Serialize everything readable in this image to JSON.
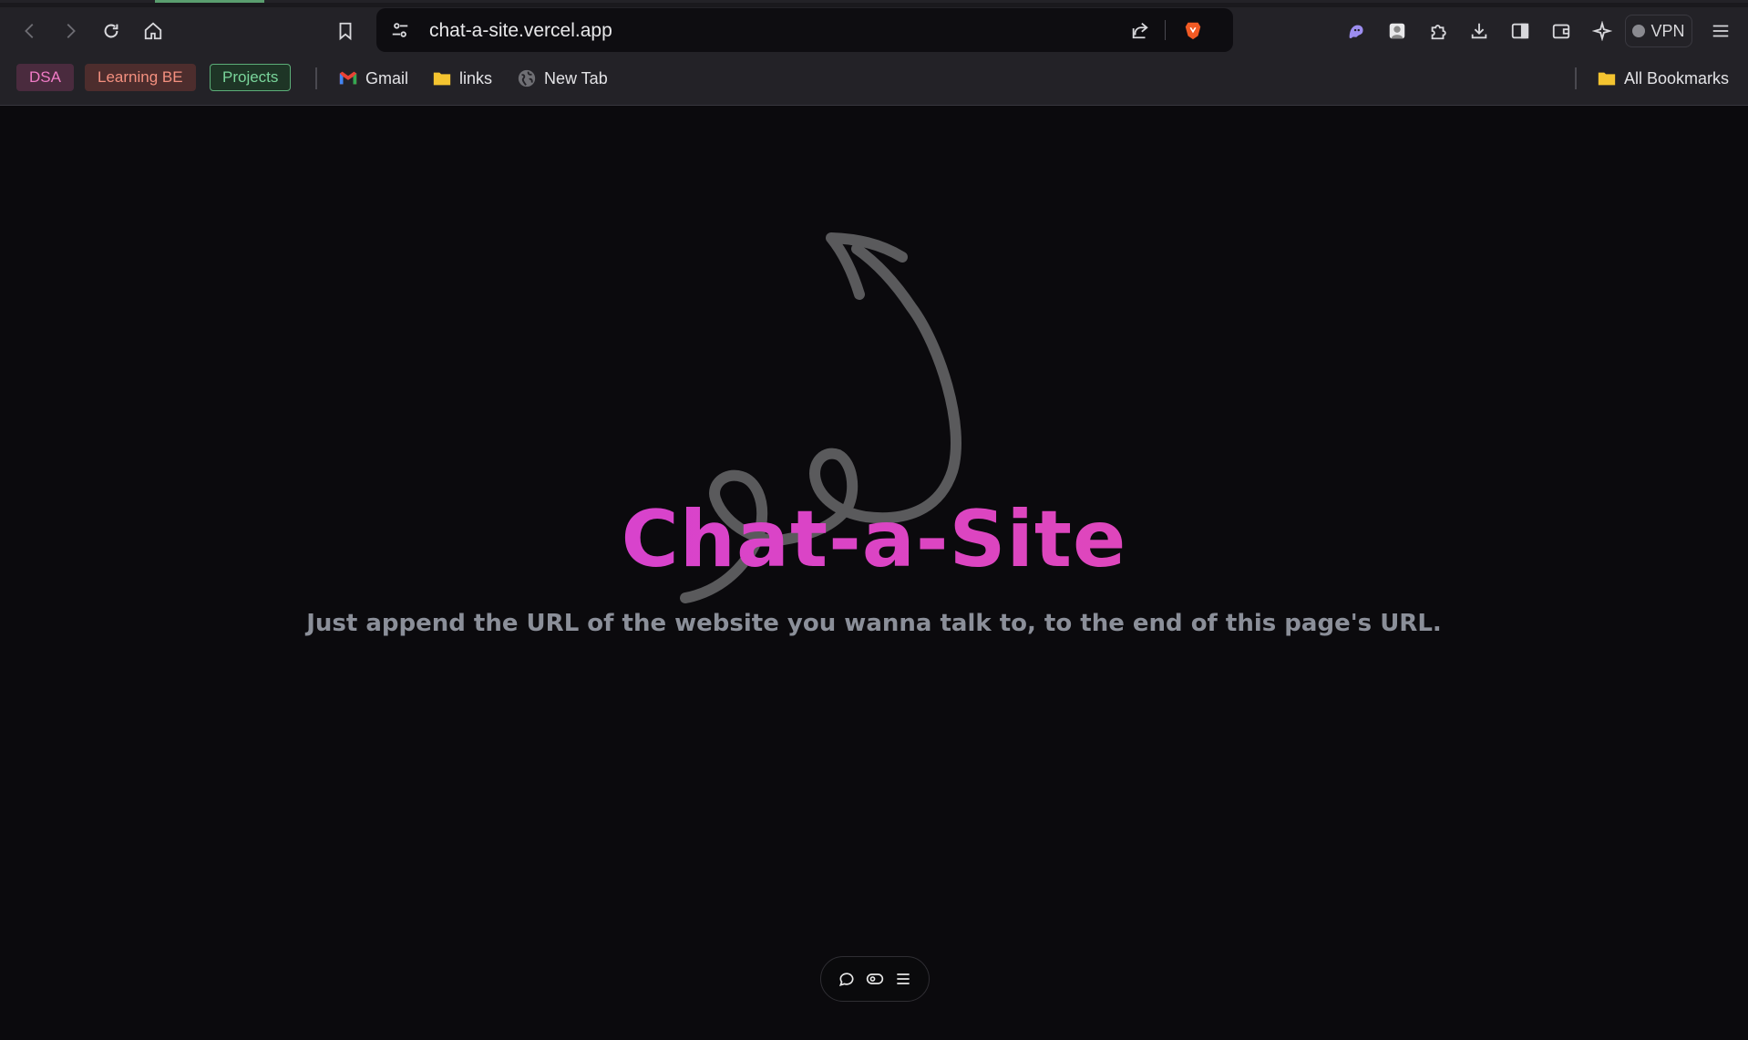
{
  "browser": {
    "url": "chat-a-site.vercel.app",
    "vpn_label": "VPN",
    "accent_tab_color": "#5a9e6f"
  },
  "bookmarks": {
    "chips": [
      {
        "label": "DSA",
        "color": "#f07bc6"
      },
      {
        "label": "Learning BE",
        "color": "#f4907f"
      },
      {
        "label": "Projects",
        "color": "#7ad59b"
      }
    ],
    "items": [
      {
        "label": "Gmail",
        "icon": "gmail-icon"
      },
      {
        "label": "links",
        "icon": "folder-icon"
      },
      {
        "label": "New Tab",
        "icon": "globe-icon"
      }
    ],
    "all_bookmarks": "All Bookmarks"
  },
  "page": {
    "title": "Chat-a-Site",
    "subtitle": "Just append the URL of the website you wanna talk to, to the end of this page's URL.",
    "title_gradient": [
      "#d03fe0",
      "#e64aa8"
    ]
  },
  "dock": {
    "icons": [
      "chat-bubble-icon",
      "eye-toggle-icon",
      "menu-icon"
    ]
  }
}
